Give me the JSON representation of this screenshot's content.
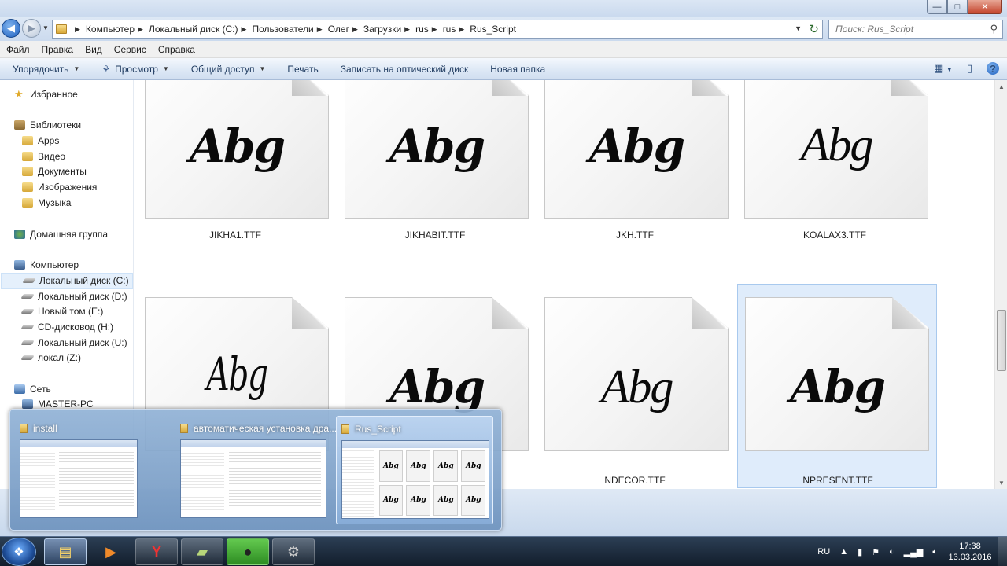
{
  "window": {
    "minimize_label": "—",
    "maximize_label": "□",
    "close_label": "✕"
  },
  "address": {
    "breadcrumbs": [
      "Компьютер",
      "Локальный диск (C:)",
      "Пользователи",
      "Олег",
      "Загрузки",
      "rus",
      "rus",
      "Rus_Script"
    ],
    "search_placeholder": "Поиск: Rus_Script"
  },
  "menubar": [
    "Файл",
    "Правка",
    "Вид",
    "Сервис",
    "Справка"
  ],
  "toolbar": {
    "organize": "Упорядочить",
    "view": "Просмотр",
    "share": "Общий доступ",
    "print": "Печать",
    "burn": "Записать на оптический диск",
    "new_folder": "Новая папка"
  },
  "sidebar": {
    "favorites": "Избранное",
    "libraries": "Библиотеки",
    "library_items": [
      "Apps",
      "Видео",
      "Документы",
      "Изображения",
      "Музыка"
    ],
    "homegroup": "Домашняя группа",
    "computer": "Компьютер",
    "drives": [
      "Локальный диск (C:)",
      "Локальный диск (D:)",
      "Новый том (E:)",
      "CD-дисковод (H:)",
      "Локальный диск (U:)",
      "локал (Z:)"
    ],
    "network": "Сеть",
    "network_items": [
      "MASTER-PC"
    ]
  },
  "files": [
    {
      "name": "JIKHA1.TTF",
      "sample": "Abg"
    },
    {
      "name": "JIKHABIT.TTF",
      "sample": "Abg"
    },
    {
      "name": "JKH.TTF",
      "sample": "Abg"
    },
    {
      "name": "KOALAX3.TTF",
      "sample": "Abg"
    },
    {
      "name": "",
      "sample": "Abg"
    },
    {
      "name": "",
      "sample": "Abg"
    },
    {
      "name": "NDECOR.TTF",
      "sample": "Abg"
    },
    {
      "name": "NPRESENT.TTF",
      "sample": "Abg"
    }
  ],
  "preview": {
    "windows": [
      "install",
      "автоматическая установка дра...",
      "Rus_Script"
    ],
    "mini_sample": "Abg"
  },
  "taskbar": {
    "language": "RU",
    "time": "17:38",
    "date": "13.03.2016"
  }
}
